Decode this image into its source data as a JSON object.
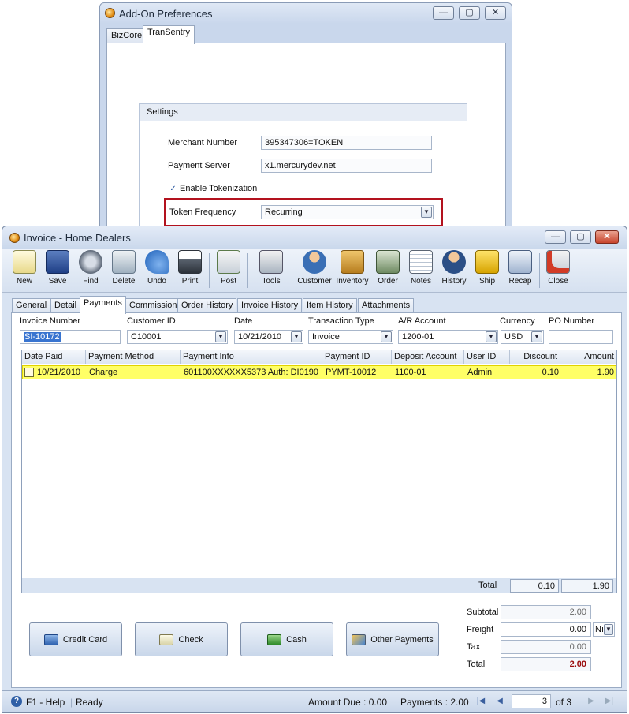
{
  "prefs": {
    "title": "Add-On Preferences",
    "tabs": [
      {
        "label": "BizCore"
      },
      {
        "label": "TranSentry"
      }
    ],
    "settings": {
      "heading": "Settings",
      "merchant_label": "Merchant Number",
      "merchant_value": "395347306=TOKEN",
      "server_label": "Payment Server",
      "server_value": "x1.mercurydev.net",
      "tokenization_label": "Enable Tokenization",
      "tokenization_checked": true,
      "frequency_label": "Token Frequency",
      "frequency_value": "Recurring"
    },
    "window_buttons": {
      "minimize": "—",
      "maximize": "▢",
      "close": "✕"
    }
  },
  "invoice": {
    "title": "Invoice - Home Dealers",
    "toolbar": [
      {
        "label": "New",
        "icon": "new-icon"
      },
      {
        "label": "Save",
        "icon": "save-icon"
      },
      {
        "label": "Find",
        "icon": "find-icon"
      },
      {
        "label": "Delete",
        "icon": "delete-icon"
      },
      {
        "label": "Undo",
        "icon": "undo-icon"
      },
      {
        "label": "Print",
        "icon": "print-icon"
      },
      {
        "label": "Post",
        "icon": "post-icon"
      },
      {
        "label": "Tools",
        "icon": "tools-icon"
      },
      {
        "label": "Customer",
        "icon": "customer-icon"
      },
      {
        "label": "Inventory",
        "icon": "inventory-icon"
      },
      {
        "label": "Order",
        "icon": "order-icon"
      },
      {
        "label": "Notes",
        "icon": "notes-icon"
      },
      {
        "label": "History",
        "icon": "history-icon"
      },
      {
        "label": "Ship",
        "icon": "ship-icon"
      },
      {
        "label": "Recap",
        "icon": "recap-icon"
      },
      {
        "label": "Close",
        "icon": "close-icon"
      }
    ],
    "tabs": [
      {
        "label": "General"
      },
      {
        "label": "Detail"
      },
      {
        "label": "Payments"
      },
      {
        "label": "Commission"
      },
      {
        "label": "Order History"
      },
      {
        "label": "Invoice History"
      },
      {
        "label": "Item History"
      },
      {
        "label": "Attachments"
      }
    ],
    "header": {
      "invoice_number_label": "Invoice Number",
      "invoice_number": "SI-10172",
      "customer_label": "Customer ID",
      "customer": "C10001",
      "date_label": "Date",
      "date": "10/21/2010",
      "type_label": "Transaction Type",
      "type": "Invoice",
      "ar_label": "A/R Account",
      "ar": "1200-01",
      "currency_label": "Currency",
      "currency": "USD",
      "po_label": "PO Number",
      "po": ""
    },
    "grid": {
      "columns": [
        "Date Paid",
        "Payment Method",
        "Payment Info",
        "Payment ID",
        "Deposit Account",
        "User ID",
        "Discount",
        "Amount"
      ],
      "rows": [
        [
          "10/21/2010",
          "Charge",
          "601100XXXXXX5373 Auth: DI0190",
          "PYMT-10012",
          "1100-01",
          "Admin",
          "0.10",
          "1.90"
        ]
      ],
      "total_label": "Total",
      "total_discount": "0.10",
      "total_amount": "1.90"
    },
    "payment_buttons": [
      {
        "label": "Credit Card",
        "icon": "credit-card-icon"
      },
      {
        "label": "Check",
        "icon": "check-icon"
      },
      {
        "label": "Cash",
        "icon": "cash-icon"
      },
      {
        "label": "Other Payments",
        "icon": "other-payments-icon"
      }
    ],
    "summary": {
      "subtotal_label": "Subtotal",
      "subtotal": "2.00",
      "freight_label": "Freight",
      "freight": "0.00",
      "freight_code": "Nı",
      "tax_label": "Tax",
      "tax": "0.00",
      "total_label": "Total",
      "total": "2.00"
    },
    "status": {
      "help": "F1 - Help",
      "state": "Ready",
      "amount_due": "Amount Due : 0.00",
      "payments": "Payments : 2.00",
      "page": "3",
      "of_pages": "of 3"
    },
    "colors": {
      "row_highlight": "#ffff66",
      "callout": "#b3121e",
      "total": "#9b0d0d"
    }
  }
}
